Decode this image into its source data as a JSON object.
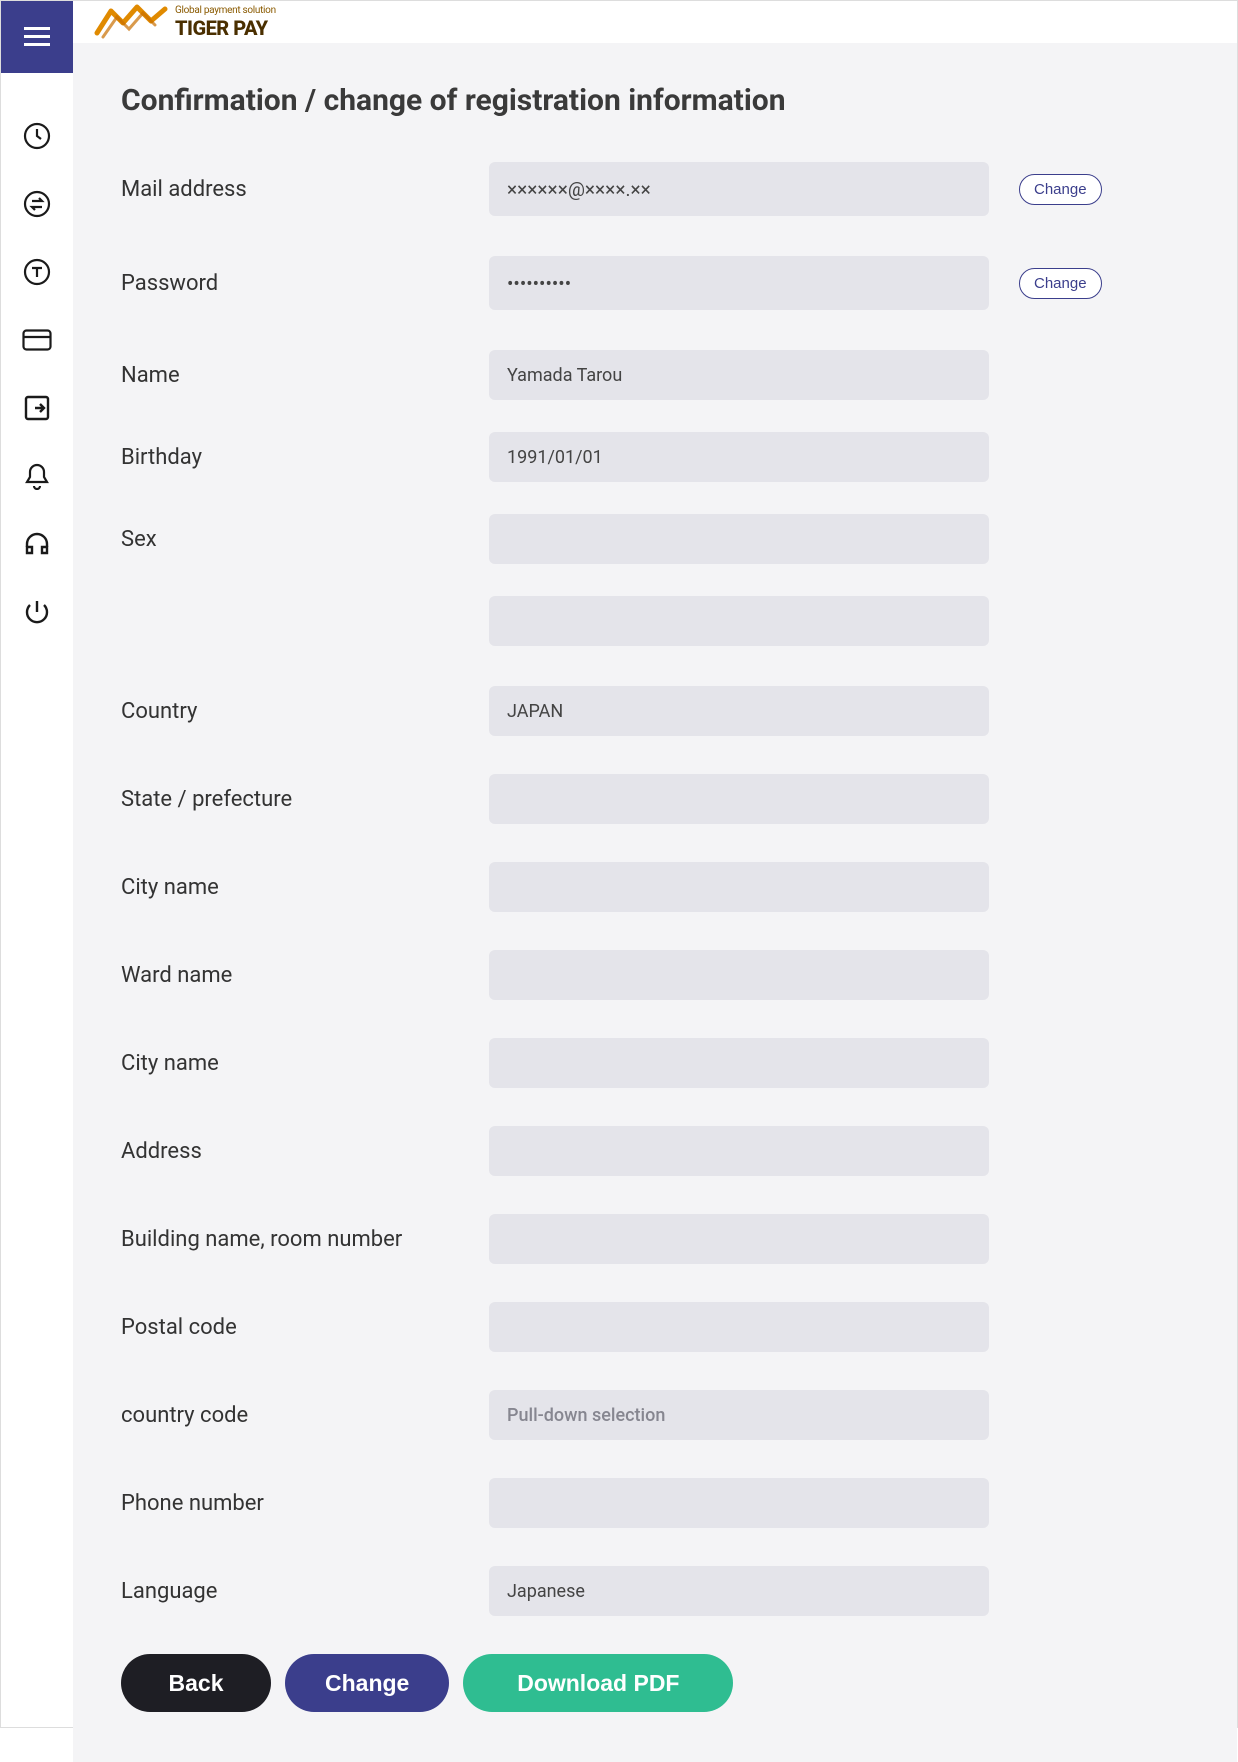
{
  "brand": {
    "tagline": "Global payment solution",
    "name": "TIGER PAY"
  },
  "page": {
    "title": "Confirmation / change of registration information"
  },
  "actions": {
    "change": "Change"
  },
  "fields": {
    "mail": {
      "label": "Mail address",
      "value": "××××××@××××.××"
    },
    "password": {
      "label": "Password",
      "value": "••••••••••"
    },
    "name": {
      "label": "Name",
      "value": "Yamada Tarou"
    },
    "birthday": {
      "label": "Birthday",
      "value": "1991/01/01"
    },
    "sex": {
      "label": "Sex",
      "value": ""
    },
    "sex2": {
      "label": "",
      "value": ""
    },
    "country": {
      "label": "Country",
      "value": "JAPAN"
    },
    "state": {
      "label": "State / prefecture",
      "value": ""
    },
    "city": {
      "label": "City name",
      "value": ""
    },
    "ward": {
      "label": "Ward name",
      "value": ""
    },
    "city2": {
      "label": "City name",
      "value": ""
    },
    "address": {
      "label": "Address",
      "value": ""
    },
    "building": {
      "label": "Building name, room number",
      "value": ""
    },
    "postal": {
      "label": "Postal code",
      "value": ""
    },
    "ccode": {
      "label": "country code",
      "value": "Pull-down selection"
    },
    "phone": {
      "label": "Phone number",
      "value": ""
    },
    "language": {
      "label": "Language",
      "value": "Japanese"
    }
  },
  "buttons": {
    "back": "Back",
    "change": "Change",
    "pdf": "Download PDF"
  }
}
